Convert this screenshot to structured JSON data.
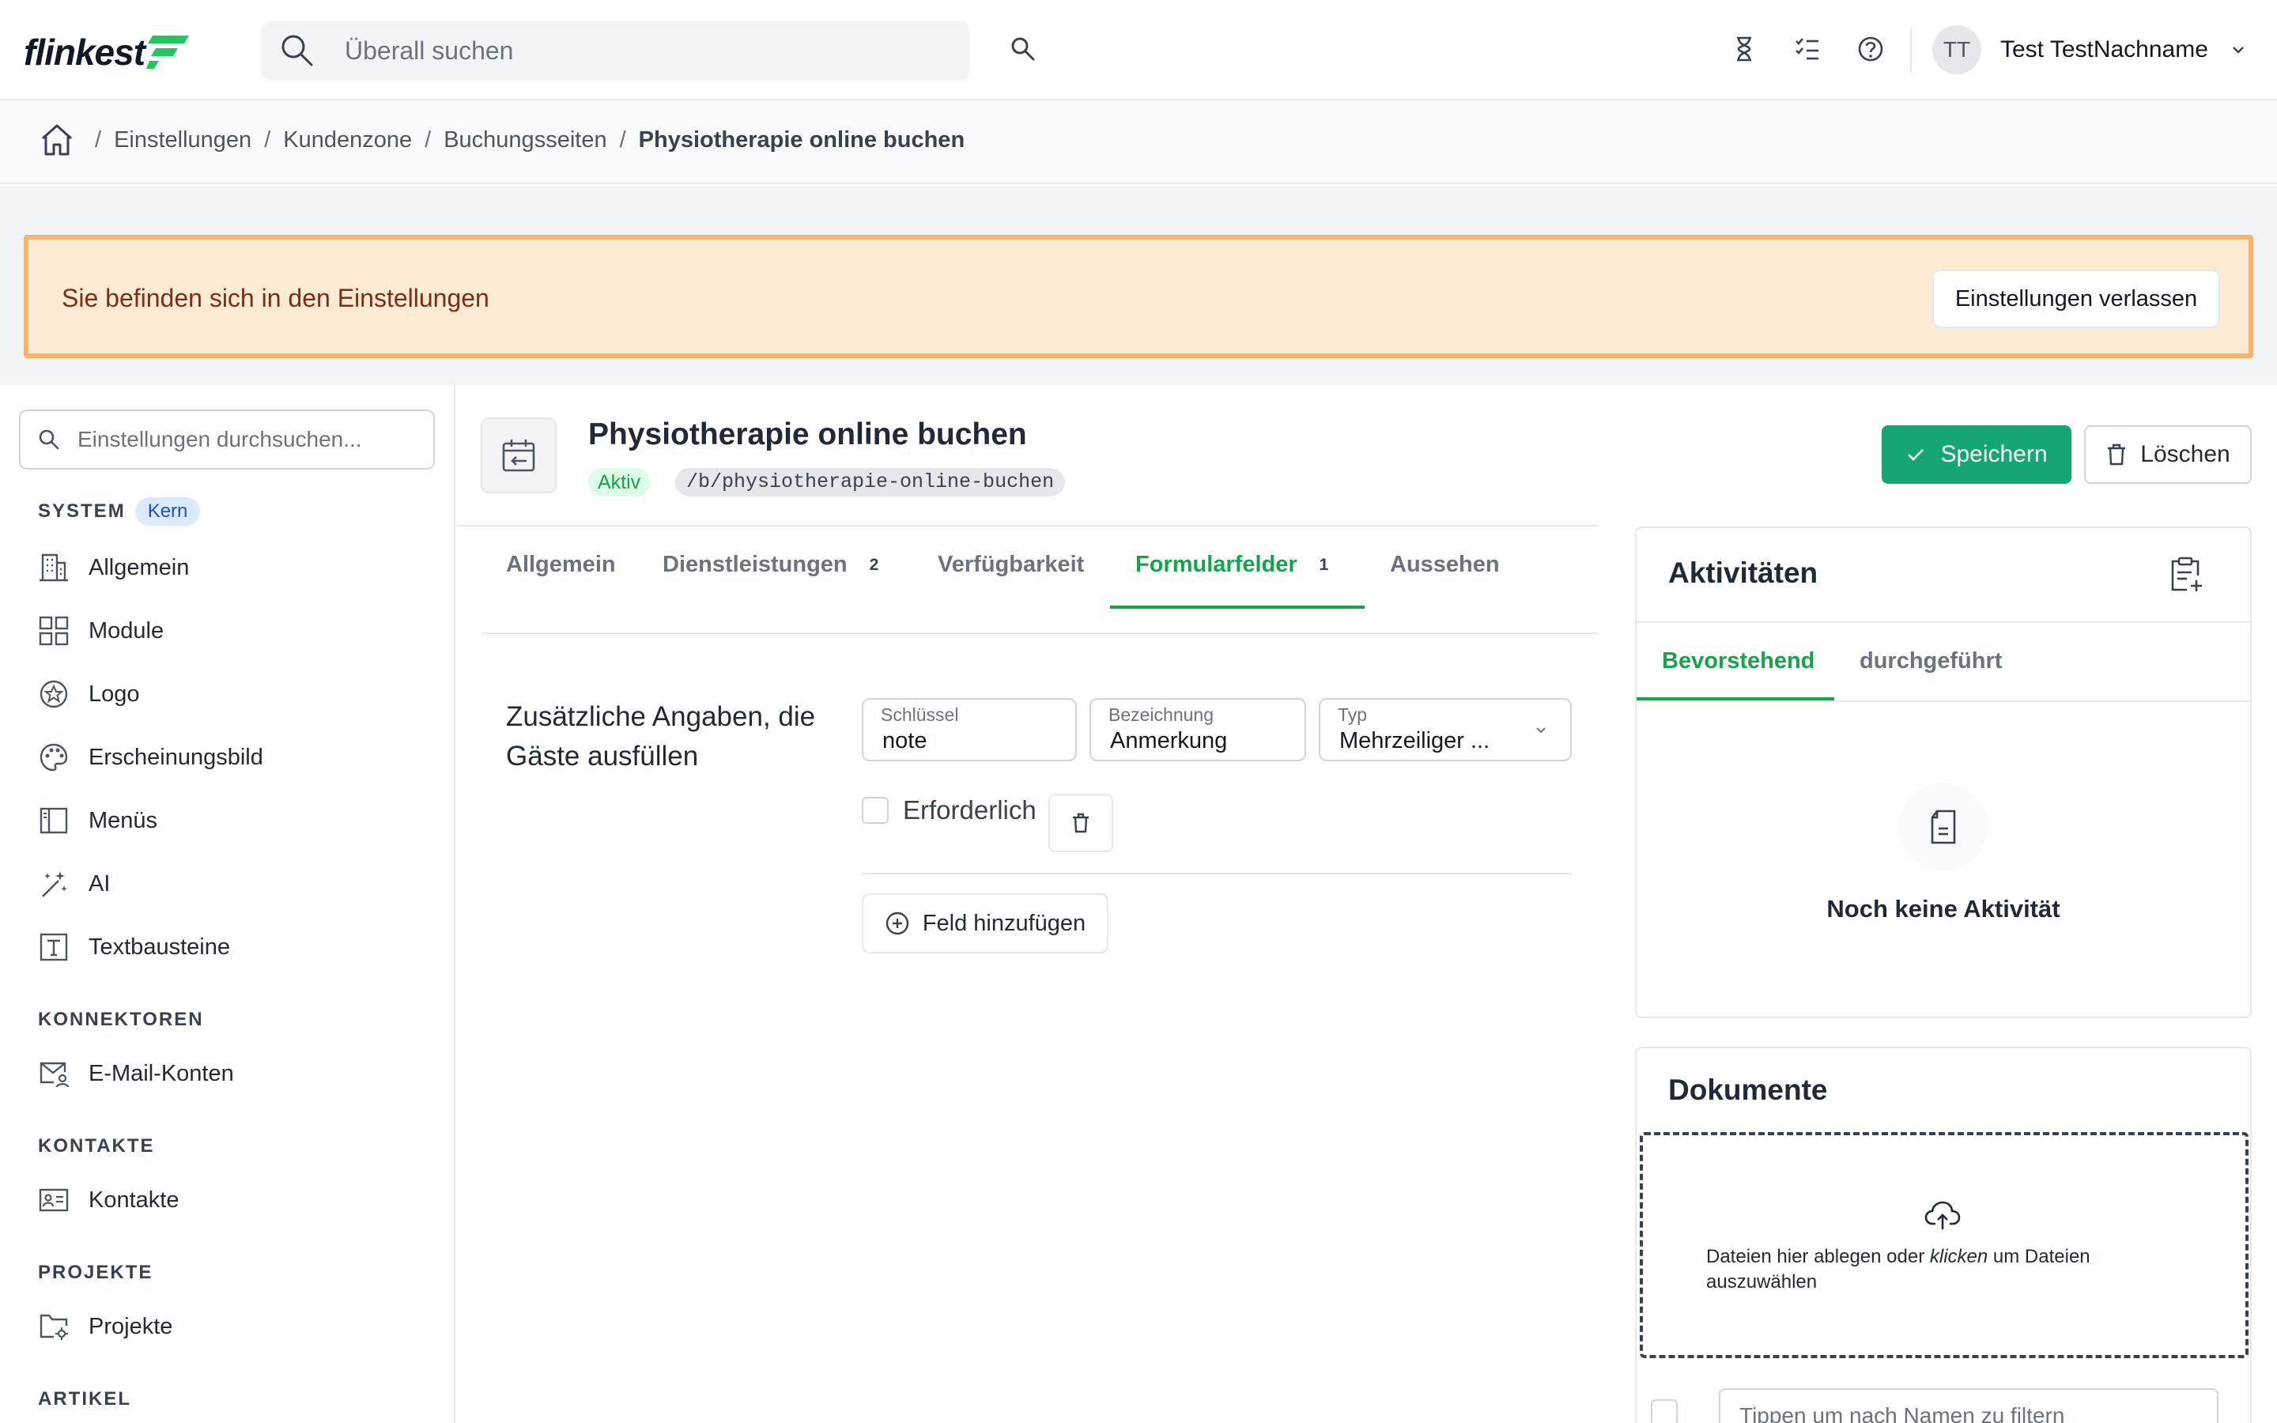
{
  "app": {
    "logo_text": "flinkest"
  },
  "header": {
    "search_placeholder": "Überall suchen",
    "user_initials": "TT",
    "user_name": "Test TestNachname"
  },
  "breadcrumb": {
    "items": [
      "Einstellungen",
      "Kundenzone",
      "Buchungsseiten"
    ],
    "current": "Physiotherapie online buchen"
  },
  "banner": {
    "text": "Sie befinden sich in den Einstellungen",
    "button": "Einstellungen verlassen"
  },
  "sidebar": {
    "search_placeholder": "Einstellungen durchsuchen...",
    "sections": [
      {
        "title": "SYSTEM",
        "badge": "Kern",
        "items": [
          "Allgemein",
          "Module",
          "Logo",
          "Erscheinungsbild",
          "Menüs",
          "AI",
          "Textbausteine"
        ]
      },
      {
        "title": "KONNEKTOREN",
        "items": [
          "E-Mail-Konten"
        ]
      },
      {
        "title": "KONTAKTE",
        "items": [
          "Kontakte"
        ]
      },
      {
        "title": "PROJEKTE",
        "items": [
          "Projekte"
        ]
      },
      {
        "title": "ARTIKEL",
        "items": []
      }
    ]
  },
  "page": {
    "title": "Physiotherapie online buchen",
    "status": "Aktiv",
    "url": "/b/physiotherapie-online-buchen",
    "save_label": "Speichern",
    "delete_label": "Löschen"
  },
  "tabs": [
    {
      "label": "Allgemein",
      "count": ""
    },
    {
      "label": "Dienstleistungen",
      "count": "2"
    },
    {
      "label": "Verfügbarkeit",
      "count": ""
    },
    {
      "label": "Formularfelder",
      "count": "1",
      "active": true
    },
    {
      "label": "Aussehen",
      "count": ""
    }
  ],
  "form_fields": {
    "section_label": "Zusätzliche Angaben, die Gäste ausfüllen",
    "key_label": "Schlüssel",
    "key_value": "note",
    "name_label": "Bezeichnung",
    "name_value": "Anmerkung",
    "type_label": "Typ",
    "type_value": "Mehrzeiliger ...",
    "required_label": "Erforderlich",
    "required_checked": false,
    "add_label": "Feld hinzufügen"
  },
  "activities": {
    "title": "Aktivitäten",
    "tabs": [
      "Bevorstehend",
      "durchgeführt"
    ],
    "active_tab": "Bevorstehend",
    "empty_text": "Noch keine Aktivität"
  },
  "documents": {
    "title": "Dokumente",
    "drop_text_before": "Dateien hier ablegen oder ",
    "drop_text_em": "klicken",
    "drop_text_after": " um Dateien auszuwählen",
    "filter_placeholder": "Tippen um nach Namen zu filtern"
  },
  "colors": {
    "primary": "#16a671",
    "banner_bg": "#fdebd3",
    "banner_border": "#f9b46a",
    "active_tab": "#16a34a"
  },
  "icons": [
    "search-icon",
    "hourglass-icon",
    "checklist-icon",
    "help-icon",
    "chevron-down-icon",
    "home-icon",
    "building-icon",
    "grid-icon",
    "star-badge-icon",
    "palette-icon",
    "sidebar-layout-icon",
    "magic-wand-icon",
    "text-icon",
    "mail-account-icon",
    "contact-card-icon",
    "folder-gear-icon",
    "calendar-arrow-icon",
    "check-icon",
    "trash-icon",
    "plus-circle-icon",
    "clipboard-plus-icon",
    "document-icon",
    "cloud-upload-icon",
    "chevron-right-icon"
  ]
}
